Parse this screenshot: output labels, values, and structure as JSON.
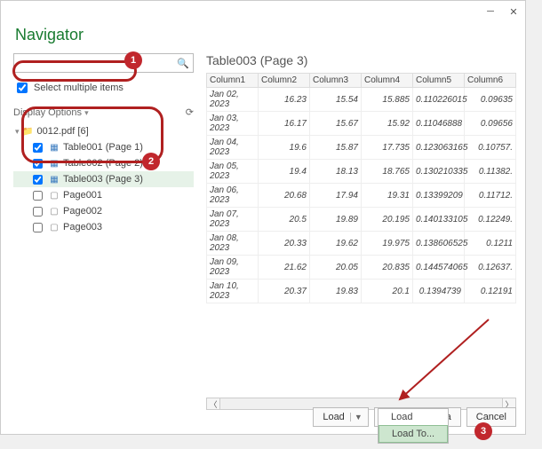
{
  "window": {
    "title": "Navigator"
  },
  "left": {
    "search_placeholder": "",
    "multi_label": "Select multiple items",
    "display_label": "Display Options",
    "root": "0012.pdf [6]",
    "items": [
      {
        "label": "Table001 (Page 1)",
        "kind": "table",
        "checked": true
      },
      {
        "label": "Table002 (Page 2)",
        "kind": "table",
        "checked": true
      },
      {
        "label": "Table003 (Page 3)",
        "kind": "table",
        "checked": true,
        "selected": true
      },
      {
        "label": "Page001",
        "kind": "page",
        "checked": false
      },
      {
        "label": "Page002",
        "kind": "page",
        "checked": false
      },
      {
        "label": "Page003",
        "kind": "page",
        "checked": false
      }
    ]
  },
  "preview": {
    "title": "Table003 (Page 3)",
    "columns": [
      "Column1",
      "Column2",
      "Column3",
      "Column4",
      "Column5",
      "Column6"
    ],
    "rows": [
      [
        "Jan 02, 2023",
        "16.23",
        "15.54",
        "15.885",
        "0.110226015",
        "0.09635"
      ],
      [
        "Jan 03, 2023",
        "16.17",
        "15.67",
        "15.92",
        "0.11046888",
        "0.09656"
      ],
      [
        "Jan 04, 2023",
        "19.6",
        "15.87",
        "17.735",
        "0.123063165",
        "0.10757."
      ],
      [
        "Jan 05, 2023",
        "19.4",
        "18.13",
        "18.765",
        "0.130210335",
        "0.11382."
      ],
      [
        "Jan 06, 2023",
        "20.68",
        "17.94",
        "19.31",
        "0.13399209",
        "0.11712."
      ],
      [
        "Jan 07, 2023",
        "20.5",
        "19.89",
        "20.195",
        "0.140133105",
        "0.12249."
      ],
      [
        "Jan 08, 2023",
        "20.33",
        "19.62",
        "19.975",
        "0.138606525",
        "0.1211"
      ],
      [
        "Jan 09, 2023",
        "21.62",
        "20.05",
        "20.835",
        "0.144574065",
        "0.12637."
      ],
      [
        "Jan 10, 2023",
        "20.37",
        "19.83",
        "20.1",
        "0.1394739",
        "0.12191"
      ]
    ]
  },
  "footer": {
    "load": "Load",
    "transform": "Transform Data",
    "cancel": "Cancel",
    "menu": [
      "Load",
      "Load To..."
    ]
  },
  "badges": {
    "b1": "1",
    "b2": "2",
    "b3": "3"
  }
}
